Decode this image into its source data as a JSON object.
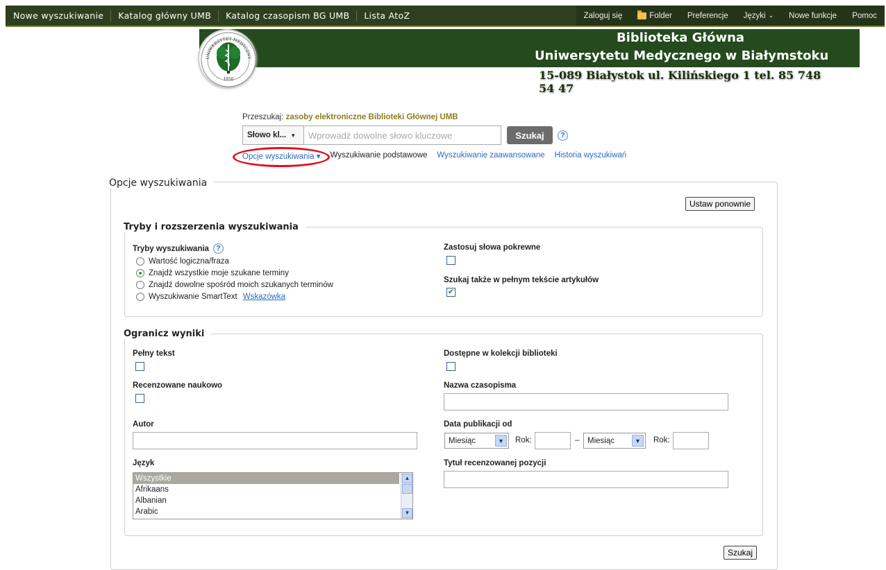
{
  "topnav": {
    "left": [
      "Nowe wyszukiwanie",
      "Katalog główny UMB",
      "Katalog czasopism BG UMB",
      "Lista AtoZ"
    ],
    "right": {
      "login": "Zaloguj się",
      "folder": "Folder",
      "preferences": "Preferencje",
      "languages": "Języki",
      "new_features": "Nowe funkcje",
      "help": "Pomoc"
    }
  },
  "header": {
    "line1": "Biblioteka Główna",
    "line2": "Uniwersytetu Medycznego w Białymstoku",
    "line3": "15-089 Białystok ul. Kilińskiego 1 tel. 85 748 54 47",
    "seal_text": "UNIWERSYTET MEDYCZNY W BIAŁYMSTOKU",
    "seal_year": "1950"
  },
  "search": {
    "label_prefix": "Przeszukaj:",
    "label_source": "zasoby elektroniczne Biblioteki Głównej UMB",
    "field_select": "Słowo kl...",
    "placeholder": "Wprowadź dowolne słowo kluczowe",
    "button": "Szukaj",
    "links": {
      "options": "Opcje wyszukiwania",
      "basic": "Wyszukiwanie podstawowe",
      "advanced": "Wyszukiwanie zaawansowane",
      "history": "Historia wyszukiwań"
    }
  },
  "options": {
    "title": "Opcje wyszukiwania",
    "reset": "Ustaw ponownie",
    "modes_section": {
      "title": "Tryby i rozszerzenia wyszukiwania",
      "modes_label": "Tryby wyszukiwania",
      "modes": [
        "Wartość logiczna/fraza",
        "Znajdź wszystkie moje szukane terminy",
        "Znajdź dowolne spośród moich szukanych terminów",
        "Wyszukiwanie SmartText"
      ],
      "selected_mode": 1,
      "hint_link": "Wskazówka",
      "related_words": "Zastosuj słowa pokrewne",
      "related_words_checked": false,
      "fulltext_search": "Szukaj także w pełnym tekście artykułów",
      "fulltext_search_checked": true
    },
    "limit_section": {
      "title": "Ogranicz wyniki",
      "full_text": "Pełny tekst",
      "available_in_library": "Dostępne w kolekcji biblioteki",
      "peer_reviewed": "Recenzowane naukowo",
      "journal_name": "Nazwa czasopisma",
      "author": "Autor",
      "pub_date": "Data publikacji od",
      "month_placeholder": "Miesiąc",
      "year_label": "Rok:",
      "dash": "–",
      "language": "Język",
      "languages": [
        "Wszystkie",
        "Afrikaans",
        "Albanian",
        "Arabic"
      ],
      "reviewed_title": "Tytuł recenzowanej pozycji"
    },
    "search_button": "Szukaj"
  }
}
